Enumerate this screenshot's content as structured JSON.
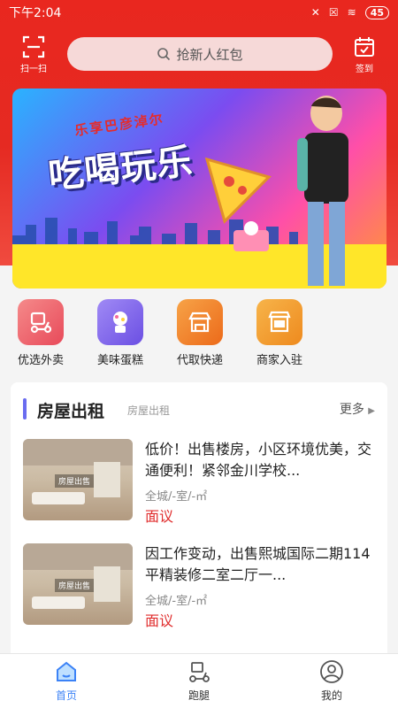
{
  "status_bar": {
    "time": "下午2:04",
    "battery": "45"
  },
  "header": {
    "scan_label": "扫一扫",
    "search_placeholder": "抢新人红包",
    "sign_label": "签到"
  },
  "banner": {
    "subtitle": "乐享巴彦淖尔",
    "headline": "吃喝玩乐"
  },
  "quick_links": [
    {
      "label": "优选外卖",
      "icon": "scooter-icon",
      "color": "#f36b6b"
    },
    {
      "label": "美味蛋糕",
      "icon": "cake-icon",
      "color": "#8f6cf3"
    },
    {
      "label": "代取快递",
      "icon": "store-icon",
      "color": "#f28a2c"
    },
    {
      "label": "商家入驻",
      "icon": "shop-counter-icon",
      "color": "#f2a12c"
    }
  ],
  "section": {
    "title": "房屋出租",
    "subtitle": "房屋出租",
    "more_label": "更多",
    "listings": [
      {
        "title": "低价！出售楼房，小区环境优美，交通便利！紧邻金川学校...",
        "meta": "全城/-室/-㎡",
        "price": "面议",
        "thumb_tag": "房屋出售"
      },
      {
        "title": "因工作变动，出售熙城国际二期114平精装修二室二厅一...",
        "meta": "全城/-室/-㎡",
        "price": "面议",
        "thumb_tag": "房屋出售"
      }
    ]
  },
  "tabbar": {
    "items": [
      {
        "label": "首页",
        "icon": "home-icon",
        "active": true
      },
      {
        "label": "跑腿",
        "icon": "errand-scooter-icon",
        "active": false
      },
      {
        "label": "我的",
        "icon": "user-icon",
        "active": false
      }
    ]
  },
  "colors": {
    "brand_red": "#e9271f",
    "accent_blue": "#3b82f6",
    "price_red": "#e02d2d"
  }
}
